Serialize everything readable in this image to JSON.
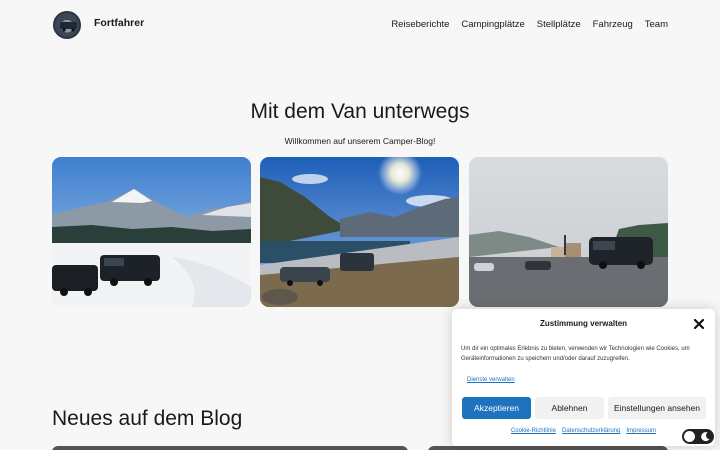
{
  "header": {
    "site_title": "Fortfahrer",
    "logo_icon": "van-logo-icon",
    "nav": [
      "Reiseberichte",
      "Campingplätze",
      "Stellplätze",
      "Fahrzeug",
      "Team"
    ]
  },
  "hero": {
    "title": "Mit dem Van unterwegs",
    "subtitle": "Willkommen auf unserem Camper-Blog!"
  },
  "gallery": {
    "photos": [
      "van-in-snowy-mountains-photo",
      "van-at-mountain-lake-photo",
      "van-on-cloudy-parking-lot-photo"
    ]
  },
  "blog": {
    "heading": "Neues auf dem Blog"
  },
  "consent": {
    "title": "Zustimmung verwalten",
    "text": "Um dir ein optimales Erlebnis zu bieten, verwenden wir Technologien wie Cookies, um Geräteinformationen zu speichern und/oder darauf zuzugreifen.",
    "services_link": "Dienste verwalten",
    "accept": "Akzeptieren",
    "deny": "Ablehnen",
    "settings": "Einstellungen ansehen",
    "footer_links": [
      "Cookie-Richtlinie",
      "Datenschutzerklärung",
      "Impressum"
    ],
    "accent_color": "#1e73be"
  },
  "theme_toggle": {
    "icon": "moon-icon"
  }
}
